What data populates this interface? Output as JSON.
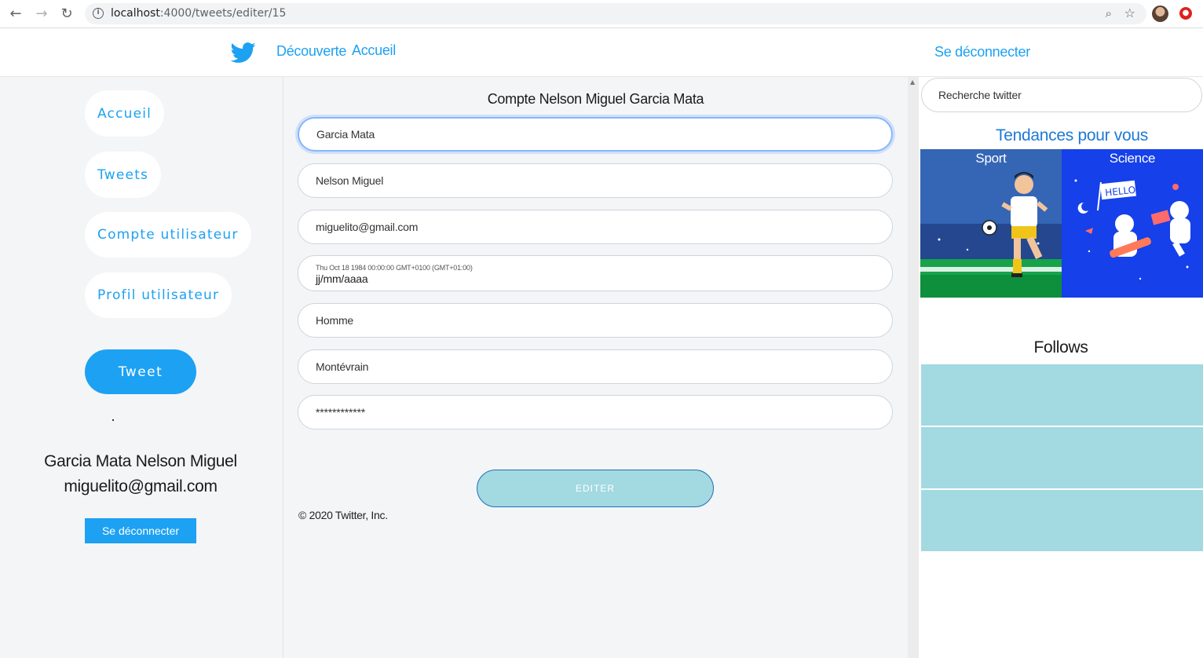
{
  "browser": {
    "url_host": "localhost",
    "url_path": ":4000/tweets/editer/15"
  },
  "topnav": {
    "decouverte": "Découverte",
    "accueil": "Accueil",
    "logout": "Se déconnecter"
  },
  "sidebar": {
    "items": [
      {
        "label": "Accueil"
      },
      {
        "label": "Tweets"
      },
      {
        "label": "Compte utilisateur"
      },
      {
        "label": "Profil utilisateur"
      }
    ],
    "tweet_button": "Tweet",
    "user_fullname": "Garcia Mata Nelson Miguel",
    "user_email": "miguelito@gmail.com",
    "logout_button": "Se déconnecter"
  },
  "form": {
    "title": "Compte Nelson Miguel Garcia Mata",
    "nom": "Garcia Mata",
    "prenom": "Nelson Miguel",
    "email": "miguelito@gmail.com",
    "birthdate_hint": "Thu Oct 18 1984 00:00:00 GMT+0100 (GMT+01:00)",
    "birthdate_placeholder": "jj/mm/aaaa",
    "genre": "Homme",
    "ville": "Montévrain",
    "password": "************",
    "submit": "EDITER",
    "copyright": "© 2020 Twitter, Inc."
  },
  "right": {
    "search_placeholder": "Recherche twitter",
    "trends_title": "Tendances pour vous",
    "trends": [
      {
        "label": "Sport"
      },
      {
        "label": "Science"
      }
    ],
    "follows_title": "Follows",
    "follows": [
      {
        "name": ""
      },
      {
        "name": ""
      },
      {
        "name": ""
      }
    ]
  },
  "colors": {
    "brand": "#1da1f2",
    "button_light": "#a3d9e1",
    "background": "#f4f5f7"
  },
  "icons": [
    "back-icon",
    "forward-icon",
    "reload-icon",
    "info-icon",
    "zoom-icon",
    "star-icon",
    "twitter-bird-icon"
  ]
}
